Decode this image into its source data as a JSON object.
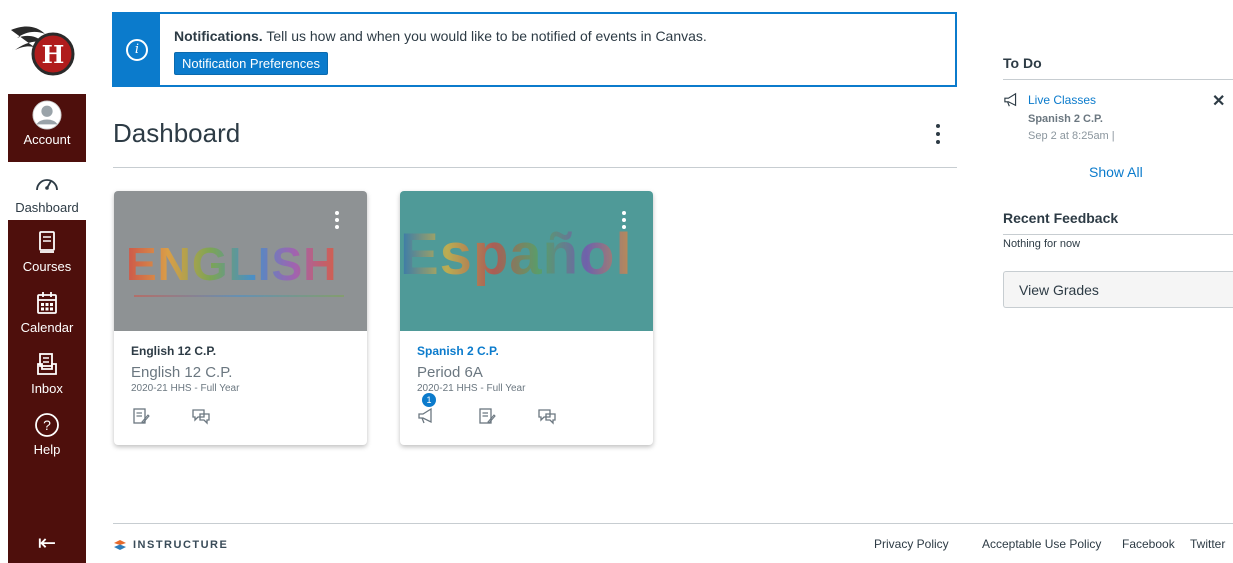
{
  "nav": {
    "account": "Account",
    "dashboard": "Dashboard",
    "courses": "Courses",
    "calendar": "Calendar",
    "inbox": "Inbox",
    "help": "Help",
    "logo_letter": "H"
  },
  "notification": {
    "title": "Notifications.",
    "message": "Tell us how and when you would like to be notified of events in Canvas.",
    "button": "Notification Preferences"
  },
  "dashboard": {
    "title": "Dashboard"
  },
  "cards": [
    {
      "hero_text": "ENGLISH",
      "name": "English 12 C.P.",
      "code": "English 12 C.P.",
      "term": "2020-21 HHS - Full Year"
    },
    {
      "hero_text": "Español",
      "name": "Spanish 2 C.P.",
      "code": "Period 6A",
      "term": "2020-21 HHS - Full Year",
      "announcement_badge": "1"
    }
  ],
  "todo": {
    "title": "To Do",
    "item_title": "Live Classes",
    "item_course": "Spanish 2 C.P.",
    "item_date": "Sep 2 at 8:25am  |",
    "show_all": "Show All"
  },
  "recent_feedback": {
    "title": "Recent Feedback",
    "empty": "Nothing for now"
  },
  "view_grades": "View Grades",
  "footer": {
    "brand": "INSTRUCTURE",
    "links": [
      "Privacy Policy",
      "Acceptable Use Policy",
      "Facebook",
      "Twitter"
    ]
  }
}
